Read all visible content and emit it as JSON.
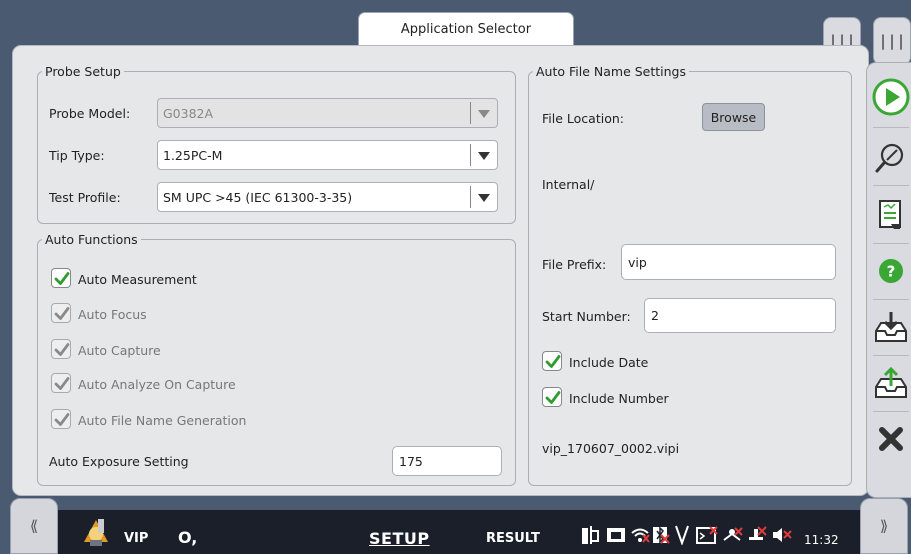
{
  "header": {
    "app_selector": "Application Selector"
  },
  "probe_setup": {
    "legend": "Probe Setup",
    "probe_model": {
      "label": "Probe Model:",
      "value": "G0382A",
      "disabled": true
    },
    "tip_type": {
      "label": "Tip Type:",
      "value": "1.25PC-M"
    },
    "test_profile": {
      "label": "Test Profile:",
      "value": "SM UPC >45 (IEC 61300-3-35)"
    }
  },
  "auto_functions": {
    "legend": "Auto Functions",
    "items": [
      {
        "label": "Auto Measurement",
        "checked": true,
        "enabled": true
      },
      {
        "label": "Auto Focus",
        "checked": true,
        "enabled": false
      },
      {
        "label": "Auto Capture",
        "checked": true,
        "enabled": false
      },
      {
        "label": "Auto Analyze On Capture",
        "checked": true,
        "enabled": false
      },
      {
        "label": "Auto File Name Generation",
        "checked": true,
        "enabled": false
      }
    ],
    "exposure": {
      "label": "Auto Exposure Setting",
      "value": "175"
    }
  },
  "auto_file_name": {
    "legend": "Auto File Name Settings",
    "file_location_label": "File Location:",
    "browse_label": "Browse",
    "location_path": "Internal/",
    "file_prefix": {
      "label": "File Prefix:",
      "value": "vip"
    },
    "start_number": {
      "label": "Start Number:",
      "value": "2"
    },
    "include_date": {
      "label": "Include Date",
      "checked": true
    },
    "include_number": {
      "label": "Include Number",
      "checked": true
    },
    "preview": "vip_170607_0002.vipi"
  },
  "right_toolbar": {
    "icons": [
      "play-icon",
      "probe-icon",
      "report-icon",
      "help-icon",
      "load-icon",
      "save-icon",
      "close-icon"
    ]
  },
  "menu_tabs": [
    "|||",
    "|||"
  ],
  "bottom_bar": {
    "left_nav": "⟪",
    "right_nav": "⟫",
    "app_name": "VIP",
    "search_glyph": "O,",
    "setup_label": "SETUP",
    "result_label": "RESULT",
    "clock": "11:32"
  },
  "colors": {
    "check_green": "#2e9d2e",
    "play_green": "#3aa735",
    "close_dark": "#333333"
  }
}
